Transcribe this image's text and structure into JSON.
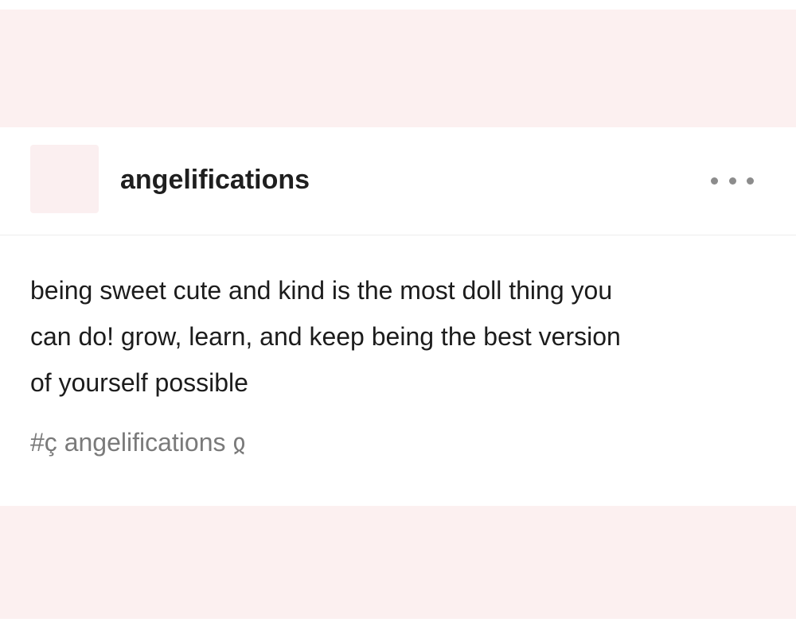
{
  "post": {
    "username": "angelifications",
    "body_lines": [
      "being sweet cute and kind is the most doll thing you",
      "can do! grow, learn, and keep being the best version",
      "of yourself possible"
    ],
    "tag": "#ç angelifications ჲ",
    "more_icon": "ellipsis-icon"
  },
  "colors": {
    "band_background": "#fcf0f0",
    "card_background": "#ffffff",
    "text_primary": "#1c1c1c",
    "tag_text": "#7a7a7a",
    "menu_dots": "#8c8c8c"
  }
}
